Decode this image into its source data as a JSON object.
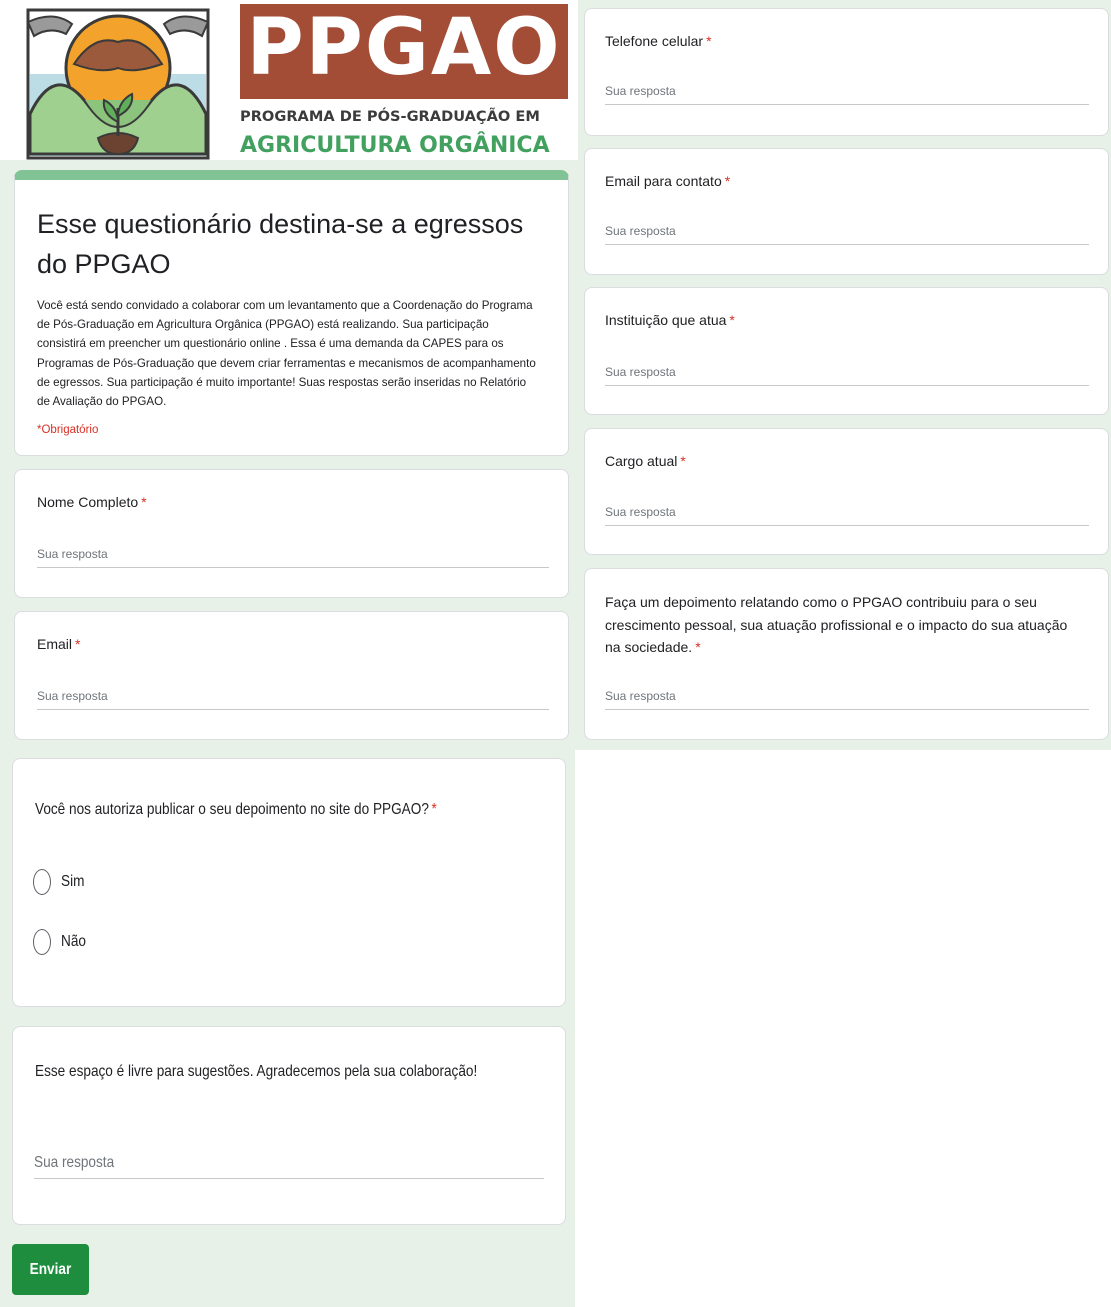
{
  "logo": {
    "acronym": "PPGAO",
    "line1": "PROGRAMA DE PÓS-GRADUAÇÃO EM",
    "line2": "AGRICULTURA ORGÂNICA"
  },
  "header": {
    "title": "Esse questionário destina-se a egressos do PPGAO",
    "description": "Você está sendo convidado a colaborar com um levantamento que a Coordenação do Programa de Pós-Graduação em Agricultura Orgânica (PPGAO) está realizando. Sua participação consistirá em preencher um questionário online . Essa é uma demanda da CAPES para os Programas de Pós-Graduação que devem criar ferramentas e mecanismos de acompanhamento de egressos. Sua participação é muito importante! Suas respostas serão inseridas no Relatório de Avaliação do PPGAO.",
    "required_note": "*Obrigatório"
  },
  "placeholder": "Sua resposta",
  "required_mark": "*",
  "questions": {
    "nome": "Nome Completo",
    "email": "Email",
    "telefone": "Telefone celular",
    "email_contato": "Email para contato",
    "instituicao": "Instituição que atua",
    "cargo": "Cargo atual",
    "depoimento": "Faça um depoimento relatando como o PPGAO contribuiu para o seu crescimento pessoal, sua atuação profissional e o impacto do sua atuação na sociedade.",
    "autoriza": "Você nos autoriza publicar o seu depoimento no site do PPGAO?",
    "sugestoes": "Esse espaço é livre para sugestões. Agradecemos pela sua colaboração!"
  },
  "options": [
    "Sim",
    "Não"
  ],
  "submit_label": "Enviar",
  "colors": {
    "accent": "#81c395",
    "background": "#e7f1e8",
    "submit": "#1e8e3e",
    "required": "#d93025",
    "logo_box": "#a34c36",
    "logo_green": "#43a160"
  }
}
